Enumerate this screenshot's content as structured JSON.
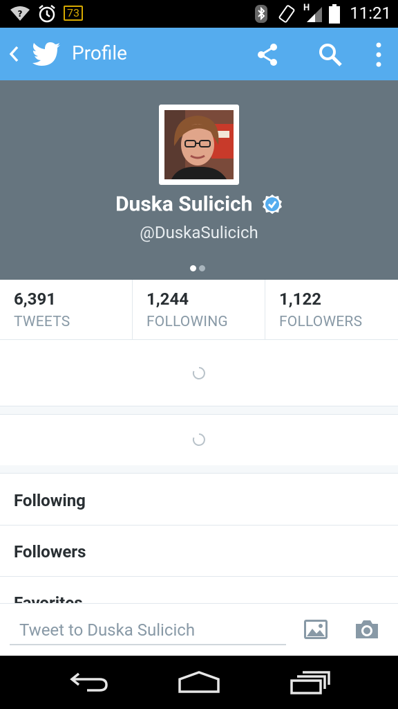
{
  "status_bar": {
    "battery_level": "73",
    "time": "11:21",
    "network": "H",
    "icons": [
      "wifi-question-icon",
      "alarm-icon",
      "bluetooth-icon",
      "rotate-icon",
      "signal-icon",
      "battery-icon"
    ]
  },
  "app_bar": {
    "title": "Profile",
    "color": "#55acee",
    "icons": [
      "back-arrow-icon",
      "twitter-bird-icon",
      "share-icon",
      "search-icon",
      "overflow-menu-icon"
    ]
  },
  "profile": {
    "name": "Duska Sulicich",
    "handle": "@DuskaSulicich",
    "verified": true,
    "header_color": "#66757f",
    "page_indicator": {
      "pages": 2,
      "active": 1
    }
  },
  "stats": [
    {
      "value": "6,391",
      "label": "TWEETS"
    },
    {
      "value": "1,244",
      "label": "FOLLOWING"
    },
    {
      "value": "1,122",
      "label": "FOLLOWERS"
    }
  ],
  "menu": [
    "Following",
    "Followers",
    "Favorites"
  ],
  "composer": {
    "placeholder": "Tweet to Duska Sulicich",
    "icons": [
      "image-icon",
      "camera-icon"
    ]
  },
  "nav_bar": {
    "icons": [
      "back-icon",
      "home-icon",
      "recents-icon"
    ]
  }
}
